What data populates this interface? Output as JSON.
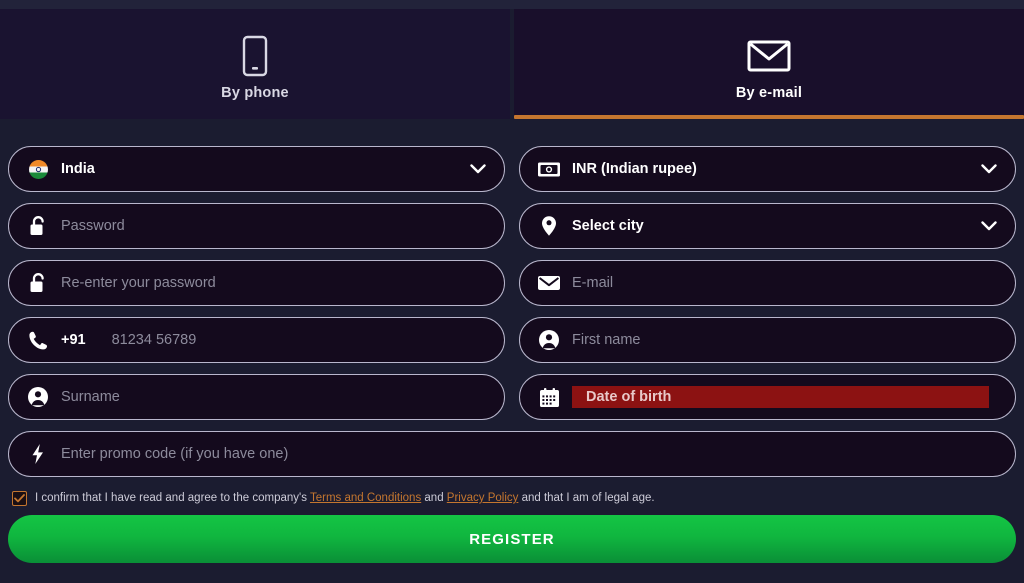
{
  "tabs": [
    {
      "label": "By phone",
      "icon": "phone-outline-icon",
      "active": false
    },
    {
      "label": "By e-mail",
      "icon": "envelope-icon",
      "active": true
    }
  ],
  "form": {
    "country": {
      "label": "India",
      "icon": "india-flag-icon",
      "filled": true
    },
    "currency": {
      "label": "INR (Indian rupee)",
      "icon": "banknote-icon",
      "filled": true
    },
    "password": {
      "placeholder": "Password",
      "icon": "open-padlock-icon"
    },
    "city": {
      "label": "Select city",
      "icon": "location-pin-icon",
      "filled": true
    },
    "password_repeat": {
      "placeholder": "Re-enter your password",
      "icon": "open-padlock-icon"
    },
    "email": {
      "placeholder": "E-mail",
      "icon": "envelope-icon"
    },
    "phone": {
      "dial_code": "+91",
      "placeholder": "81234 56789",
      "icon": "phone-handset-icon"
    },
    "first_name": {
      "placeholder": "First name",
      "icon": "user-circle-icon"
    },
    "surname": {
      "placeholder": "Surname",
      "icon": "user-circle-icon"
    },
    "date_of_birth": {
      "placeholder": "Date of birth",
      "icon": "calendar-icon",
      "error": true
    },
    "promo": {
      "placeholder": "Enter promo code (if you have one)",
      "icon": "lightning-bolt-icon"
    }
  },
  "terms": {
    "checked": true,
    "before": "I confirm that I have read and agree to the company's",
    "link1": "Terms and Conditions",
    "middle": "and",
    "link2": "Privacy Policy",
    "after": "and that I am of legal age."
  },
  "register": {
    "label": "REGISTER"
  },
  "colors": {
    "accent_orange": "#c4762f",
    "register_green": "#10b63f",
    "error_red": "#8c1212",
    "page_bg": "#1b1c30",
    "field_bg": "#140a1d"
  }
}
